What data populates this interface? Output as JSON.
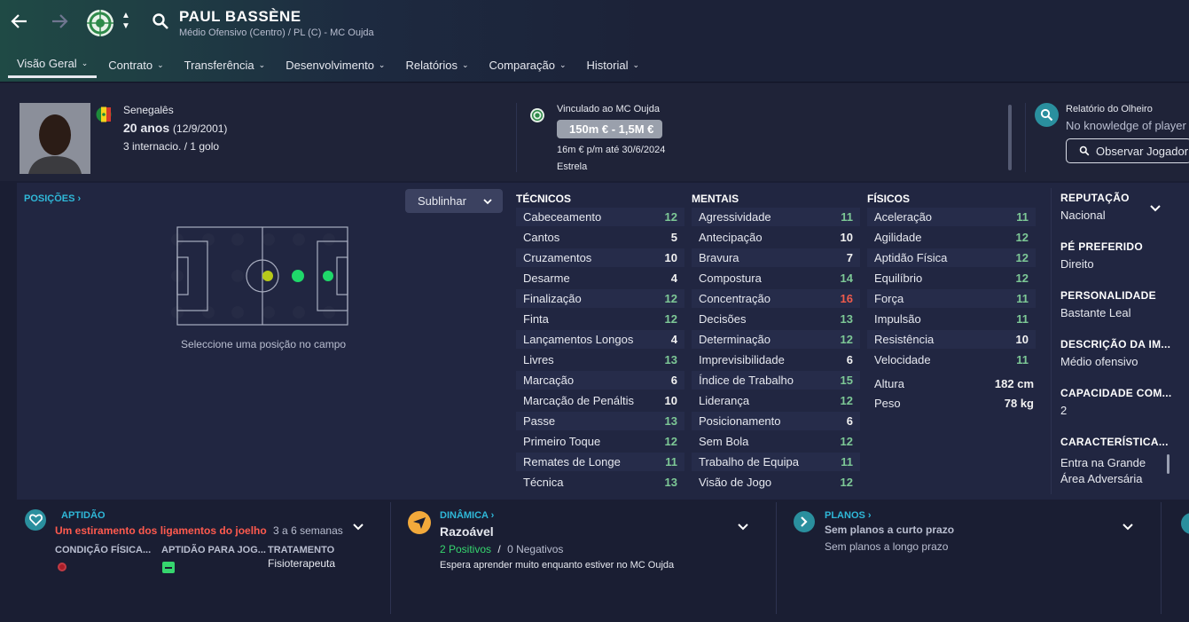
{
  "header": {
    "name": "PAUL BASSÈNE",
    "subtitle": "Médio Ofensivo (Centro) / PL (C) - MC Oujda",
    "tabs": [
      {
        "label": "Visão Geral"
      },
      {
        "label": "Contrato"
      },
      {
        "label": "Transferência"
      },
      {
        "label": "Desenvolvimento"
      },
      {
        "label": "Relatórios"
      },
      {
        "label": "Comparação"
      },
      {
        "label": "Historial"
      }
    ]
  },
  "profile": {
    "nationality": "Senegalês",
    "age": "20 anos",
    "birth": "(12/9/2001)",
    "caps": "3 internacio. / 1 golo"
  },
  "contract": {
    "club_line": "Vinculado ao MC Oujda",
    "value": "150m € - 1,5M €",
    "wage": "16m € p/m até 30/6/2024",
    "status": "Estrela"
  },
  "scout": {
    "title": "Relatório do Olheiro",
    "text": "No knowledge of player",
    "button": "Observar Jogador"
  },
  "positions": {
    "title": "POSIÇÕES",
    "dropdown": "Sublinhar",
    "hint": "Seleccione uma posição no campo"
  },
  "technical": {
    "title": "TÉCNICOS",
    "rows": [
      {
        "name": "Cabeceamento",
        "value": "12",
        "tone": "green"
      },
      {
        "name": "Cantos",
        "value": "5",
        "tone": "white"
      },
      {
        "name": "Cruzamentos",
        "value": "10",
        "tone": "white"
      },
      {
        "name": "Desarme",
        "value": "4",
        "tone": "white"
      },
      {
        "name": "Finalização",
        "value": "12",
        "tone": "green"
      },
      {
        "name": "Finta",
        "value": "12",
        "tone": "green"
      },
      {
        "name": "Lançamentos Longos",
        "value": "4",
        "tone": "white"
      },
      {
        "name": "Livres",
        "value": "13",
        "tone": "green"
      },
      {
        "name": "Marcação",
        "value": "6",
        "tone": "white"
      },
      {
        "name": "Marcação de Penáltis",
        "value": "10",
        "tone": "white"
      },
      {
        "name": "Passe",
        "value": "13",
        "tone": "green"
      },
      {
        "name": "Primeiro Toque",
        "value": "12",
        "tone": "green"
      },
      {
        "name": "Remates de Longe",
        "value": "11",
        "tone": "green"
      },
      {
        "name": "Técnica",
        "value": "13",
        "tone": "green"
      }
    ]
  },
  "mental": {
    "title": "MENTAIS",
    "rows": [
      {
        "name": "Agressividade",
        "value": "11",
        "tone": "green"
      },
      {
        "name": "Antecipação",
        "value": "10",
        "tone": "white"
      },
      {
        "name": "Bravura",
        "value": "7",
        "tone": "white"
      },
      {
        "name": "Compostura",
        "value": "14",
        "tone": "green"
      },
      {
        "name": "Concentração",
        "value": "16",
        "tone": "red"
      },
      {
        "name": "Decisões",
        "value": "13",
        "tone": "green"
      },
      {
        "name": "Determinação",
        "value": "12",
        "tone": "green"
      },
      {
        "name": "Imprevisibilidade",
        "value": "6",
        "tone": "white"
      },
      {
        "name": "Índice de Trabalho",
        "value": "15",
        "tone": "green"
      },
      {
        "name": "Liderança",
        "value": "12",
        "tone": "green"
      },
      {
        "name": "Posicionamento",
        "value": "6",
        "tone": "white"
      },
      {
        "name": "Sem Bola",
        "value": "12",
        "tone": "green"
      },
      {
        "name": "Trabalho de Equipa",
        "value": "11",
        "tone": "green"
      },
      {
        "name": "Visão de Jogo",
        "value": "12",
        "tone": "green"
      }
    ]
  },
  "physical": {
    "title": "FÍSICOS",
    "rows": [
      {
        "name": "Aceleração",
        "value": "11",
        "tone": "green"
      },
      {
        "name": "Agilidade",
        "value": "12",
        "tone": "green"
      },
      {
        "name": "Aptidão Física",
        "value": "12",
        "tone": "green"
      },
      {
        "name": "Equilíbrio",
        "value": "12",
        "tone": "green"
      },
      {
        "name": "Força",
        "value": "11",
        "tone": "green"
      },
      {
        "name": "Impulsão",
        "value": "11",
        "tone": "green"
      },
      {
        "name": "Resistência",
        "value": "10",
        "tone": "white"
      },
      {
        "name": "Velocidade",
        "value": "11",
        "tone": "green"
      }
    ],
    "height_label": "Altura",
    "height": "182 cm",
    "weight_label": "Peso",
    "weight": "78 kg"
  },
  "side": [
    {
      "label": "REPUTAÇÃO",
      "value": "Nacional"
    },
    {
      "label": "PÉ PREFERIDO",
      "value": "Direito"
    },
    {
      "label": "PERSONALIDADE",
      "value": "Bastante Leal"
    },
    {
      "label": "DESCRIÇÃO DA IM...",
      "value": "Médio ofensivo"
    },
    {
      "label": "CAPACIDADE COM...",
      "value": "2"
    },
    {
      "label": "CARACTERÍSTICA...",
      "value": "Entra na Grande Área Adversária"
    }
  ],
  "fitness": {
    "title": "APTIDÃO",
    "injury": "Um estiramento dos ligamentos do joelho",
    "duration": "3 a 6 semanas",
    "col1": "CONDIÇÃO FÍSICA...",
    "col2": "APTIDÃO PARA JOG...",
    "col3": "TRATAMENTO",
    "treatment": "Fisioterapeuta"
  },
  "dynamics": {
    "title": "DINÂMICA",
    "rating": "Razoável",
    "positives": "2 Positivos",
    "slash": "/",
    "negatives": "0 Negativos",
    "note": "Espera aprender muito enquanto estiver no MC Oujda"
  },
  "plans": {
    "title": "PLANOS",
    "short": "Sem planos a curto prazo",
    "long": "Sem planos a longo prazo"
  },
  "colors": {
    "accent": "#2fb8d8",
    "green": "#7dc896",
    "red": "#ef5b4c",
    "injury": "#ff5a4e"
  }
}
